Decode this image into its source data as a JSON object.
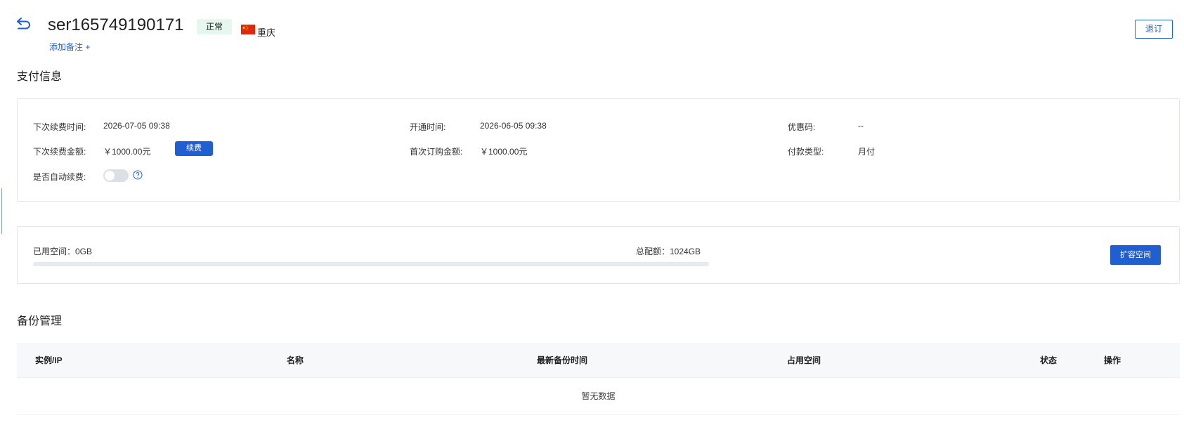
{
  "header": {
    "server_id": "ser165749190171",
    "status": "正常",
    "region": "重庆",
    "add_note": "添加备注 +",
    "refund_button": "退订"
  },
  "payment_section": {
    "title": "支付信息",
    "next_renew_time_label": "下次续费时间:",
    "next_renew_time": "2026-07-05 09:38",
    "open_time_label": "开通时间:",
    "open_time": "2026-06-05 09:38",
    "coupon_label": "优惠码:",
    "coupon": "--",
    "next_renew_amount_label": "下次续费金额:",
    "next_renew_amount": "￥1000.00元",
    "renew_button": "续费",
    "first_order_amount_label": "首次订购金额:",
    "first_order_amount": "￥1000.00元",
    "payment_type_label": "付款类型:",
    "payment_type": "月付",
    "auto_renew_label": "是否自动续费:",
    "auto_renew_enabled": false
  },
  "storage": {
    "used_label": "已用空间：0GB",
    "total_label": "总配额：1024GB",
    "used_fraction": 0,
    "expand_button": "扩容空间"
  },
  "backup": {
    "title": "备份管理",
    "columns": [
      "实例/IP",
      "名称",
      "最新备份时间",
      "占用空间",
      "状态",
      "操作"
    ],
    "empty_text": "暂无数据"
  },
  "colors": {
    "accent": "#1f5fd1",
    "status_bg": "#e6f7f0"
  }
}
